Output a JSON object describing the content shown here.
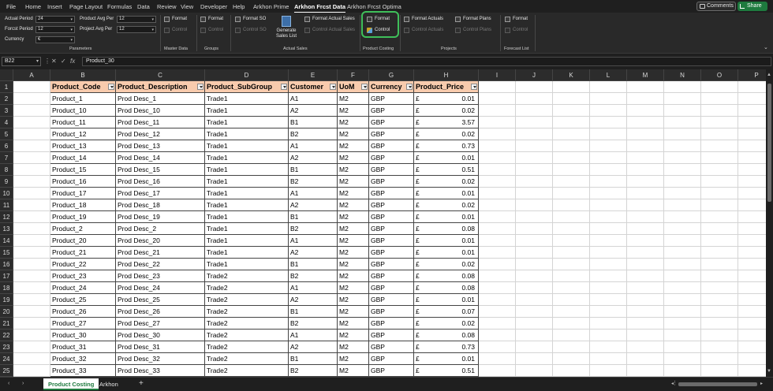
{
  "menu": {
    "items": [
      "File",
      "Home",
      "Insert",
      "Page Layout",
      "Formulas",
      "Data",
      "Review",
      "View",
      "Developer",
      "Help",
      "Arkhon Prime",
      "Arkhon Frcst Data",
      "Arkhon Frcst Optima"
    ],
    "active": "Arkhon Frcst Data",
    "comments_label": "Comments",
    "share_label": "Share"
  },
  "ribbon": {
    "params": {
      "actual_period_label": "Actual Period",
      "actual_period_value": "24",
      "frcst_period_label": "Forcst Period",
      "frcst_period_value": "12",
      "currency_label": "Currency",
      "currency_value": "€",
      "product_avg_per_label": "Product Avg Per",
      "product_avg_per_value": "12",
      "project_avg_per_label": "Project Avg Per",
      "project_avg_per_value": "12",
      "group_label": "Parameters"
    },
    "master_data": {
      "format": "Format",
      "control": "Control",
      "group_label": "Master Data"
    },
    "groups": {
      "format": "Format",
      "control": "Control",
      "group_label": "Groups"
    },
    "actual_sales": {
      "format_so": "Format SO",
      "control_so": "Control SO",
      "generate_line1": "Generate",
      "generate_line2": "Sales List",
      "format_actual_sales": "Format Actual Sales",
      "control_actual_sales": "Control Actual Sales",
      "group_label": "Actual Sales"
    },
    "product_costing": {
      "format": "Format",
      "control": "Control",
      "group_label": "Product Costing"
    },
    "projects": {
      "format_actuals": "Format Actuals",
      "control_actuals": "Control Actuals",
      "format_plans": "Format Plans",
      "control_plans": "Control Plans",
      "group_label": "Projects"
    },
    "forecast_list": {
      "format": "Format",
      "control": "Control",
      "group_label": "Forecast List"
    }
  },
  "formula_bar": {
    "name_box": "B22",
    "cancel": "✕",
    "enter": "✓",
    "fx": "fx",
    "formula": "Product_30"
  },
  "columns": [
    "A",
    "B",
    "C",
    "D",
    "E",
    "F",
    "G",
    "H",
    "I",
    "J",
    "K",
    "L",
    "M",
    "N",
    "O",
    "P"
  ],
  "rows": [
    "1",
    "2",
    "3",
    "4",
    "5",
    "6",
    "7",
    "8",
    "9",
    "10",
    "11",
    "12",
    "13",
    "14",
    "15",
    "16",
    "17",
    "18",
    "19",
    "20",
    "21",
    "22",
    "23",
    "24",
    "25"
  ],
  "table": {
    "headers": [
      "Product_Code",
      "Product_Description",
      "Product_SubGroup",
      "Customer",
      "UoM",
      "Currency",
      "Product_Price"
    ],
    "rows": [
      [
        "Product_1",
        "Prod Desc_1",
        "Trade1",
        "A1",
        "M2",
        "GBP",
        "£",
        "0.01"
      ],
      [
        "Product_10",
        "Prod Desc_10",
        "Trade1",
        "A2",
        "M2",
        "GBP",
        "£",
        "0.02"
      ],
      [
        "Product_11",
        "Prod Desc_11",
        "Trade1",
        "B1",
        "M2",
        "GBP",
        "£",
        "3.57"
      ],
      [
        "Product_12",
        "Prod Desc_12",
        "Trade1",
        "B2",
        "M2",
        "GBP",
        "£",
        "0.02"
      ],
      [
        "Product_13",
        "Prod Desc_13",
        "Trade1",
        "A1",
        "M2",
        "GBP",
        "£",
        "0.73"
      ],
      [
        "Product_14",
        "Prod Desc_14",
        "Trade1",
        "A2",
        "M2",
        "GBP",
        "£",
        "0.01"
      ],
      [
        "Product_15",
        "Prod Desc_15",
        "Trade1",
        "B1",
        "M2",
        "GBP",
        "£",
        "0.51"
      ],
      [
        "Product_16",
        "Prod Desc_16",
        "Trade1",
        "B2",
        "M2",
        "GBP",
        "£",
        "0.02"
      ],
      [
        "Product_17",
        "Prod Desc_17",
        "Trade1",
        "A1",
        "M2",
        "GBP",
        "£",
        "0.01"
      ],
      [
        "Product_18",
        "Prod Desc_18",
        "Trade1",
        "A2",
        "M2",
        "GBP",
        "£",
        "0.02"
      ],
      [
        "Product_19",
        "Prod Desc_19",
        "Trade1",
        "B1",
        "M2",
        "GBP",
        "£",
        "0.01"
      ],
      [
        "Product_2",
        "Prod Desc_2",
        "Trade1",
        "B2",
        "M2",
        "GBP",
        "£",
        "0.08"
      ],
      [
        "Product_20",
        "Prod Desc_20",
        "Trade1",
        "A1",
        "M2",
        "GBP",
        "£",
        "0.01"
      ],
      [
        "Product_21",
        "Prod Desc_21",
        "Trade1",
        "A2",
        "M2",
        "GBP",
        "£",
        "0.01"
      ],
      [
        "Product_22",
        "Prod Desc_22",
        "Trade1",
        "B1",
        "M2",
        "GBP",
        "£",
        "0.02"
      ],
      [
        "Product_23",
        "Prod Desc_23",
        "Trade2",
        "B2",
        "M2",
        "GBP",
        "£",
        "0.08"
      ],
      [
        "Product_24",
        "Prod Desc_24",
        "Trade2",
        "A1",
        "M2",
        "GBP",
        "£",
        "0.08"
      ],
      [
        "Product_25",
        "Prod Desc_25",
        "Trade2",
        "A2",
        "M2",
        "GBP",
        "£",
        "0.01"
      ],
      [
        "Product_26",
        "Prod Desc_26",
        "Trade2",
        "B1",
        "M2",
        "GBP",
        "£",
        "0.07"
      ],
      [
        "Product_27",
        "Prod Desc_27",
        "Trade2",
        "B2",
        "M2",
        "GBP",
        "£",
        "0.02"
      ],
      [
        "Product_30",
        "Prod Desc_30",
        "Trade2",
        "A1",
        "M2",
        "GBP",
        "£",
        "0.08"
      ],
      [
        "Product_31",
        "Prod Desc_31",
        "Trade2",
        "A2",
        "M2",
        "GBP",
        "£",
        "0.73"
      ],
      [
        "Product_32",
        "Prod Desc_32",
        "Trade2",
        "B1",
        "M2",
        "GBP",
        "£",
        "0.01"
      ],
      [
        "Product_33",
        "Prod Desc_33",
        "Trade2",
        "B2",
        "M2",
        "GBP",
        "£",
        "0.51"
      ]
    ]
  },
  "sheets": {
    "tabs": [
      "Product Costing",
      "Arkhon"
    ],
    "active": "Product Costing",
    "add": "+",
    "nav_prev": "‹",
    "nav_next": "›",
    "more": "⋮"
  },
  "colors": {
    "header_fill": "#f8cbad",
    "highlight": "#3fbf5a",
    "accent_green": "#1e7a3e"
  }
}
